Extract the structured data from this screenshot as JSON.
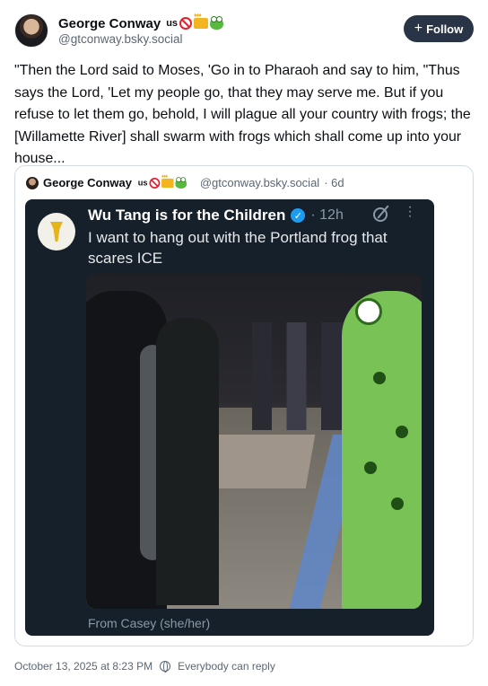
{
  "author": {
    "display_name": "George Conway",
    "country_code": "us",
    "handle": "@gtconway.bsky.social"
  },
  "actions": {
    "follow_label": "Follow"
  },
  "post": {
    "text": "\"Then the Lord said to Moses, 'Go in to Pharaoh and say to him, \"Thus says the Lord, 'Let my people go, that they may serve me. But if you refuse to let them go, behold, I will plague all your country with frogs; the [Willamette River] shall swarm with frogs which shall come up into your house..."
  },
  "quote": {
    "display_name": "George Conway",
    "country_code": "us",
    "handle": "@gtconway.bsky.social",
    "age": "· 6d",
    "embedded": {
      "author": "Wu Tang is for the Children",
      "time": "· 12h",
      "text": "I want to hang out with the Portland frog that scares ICE",
      "from": "From Casey (she/her)"
    }
  },
  "footer": {
    "timestamp": "October 13, 2025 at 8:23 PM",
    "visibility": "Everybody can reply"
  }
}
